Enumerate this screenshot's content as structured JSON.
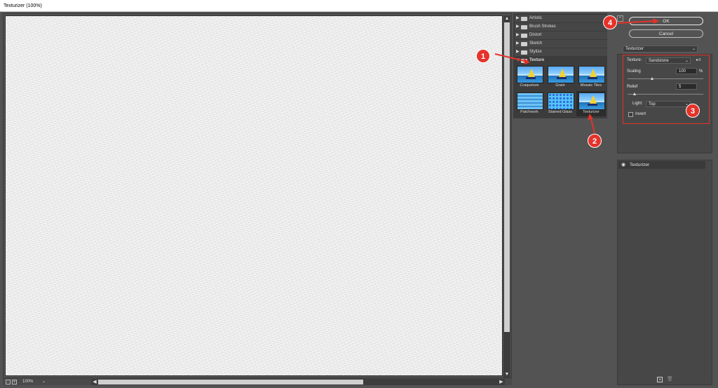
{
  "window": {
    "title": "Texturizer (100%)"
  },
  "preview": {
    "zoom_level": "100%",
    "zoom_out": "-",
    "zoom_in": "+"
  },
  "gallery": {
    "categories": [
      {
        "label": "Artistic",
        "expanded": false
      },
      {
        "label": "Brush Strokes",
        "expanded": false
      },
      {
        "label": "Distort",
        "expanded": false
      },
      {
        "label": "Sketch",
        "expanded": false
      },
      {
        "label": "Stylize",
        "expanded": false
      },
      {
        "label": "Texture",
        "expanded": true
      }
    ],
    "thumbnails": [
      {
        "label": "Craquelure"
      },
      {
        "label": "Grain"
      },
      {
        "label": "Mosaic Tiles"
      },
      {
        "label": "Patchwork"
      },
      {
        "label": "Stained Glass"
      },
      {
        "label": "Texturizer",
        "selected": true
      }
    ]
  },
  "buttons": {
    "ok": "OK",
    "cancel": "Cancel"
  },
  "filter_select": {
    "value": "Texturizer"
  },
  "settings": {
    "texture_label": "Texture:",
    "texture_value": "Sandstone",
    "scaling_label": "Scaling",
    "scaling_value": "100",
    "scaling_unit": "%",
    "scaling_fraction": 0.33,
    "relief_label": "Relief",
    "relief_value": "5",
    "relief_fraction": 0.1,
    "light_label": "Light:",
    "light_value": "Top",
    "invert_label": "Invert",
    "invert_checked": false
  },
  "layers": {
    "items": [
      {
        "label": "Texturizer"
      }
    ]
  },
  "callouts": [
    "1",
    "2",
    "3",
    "4"
  ],
  "colors": {
    "callout": "#e5332a",
    "panel": "#535353"
  }
}
